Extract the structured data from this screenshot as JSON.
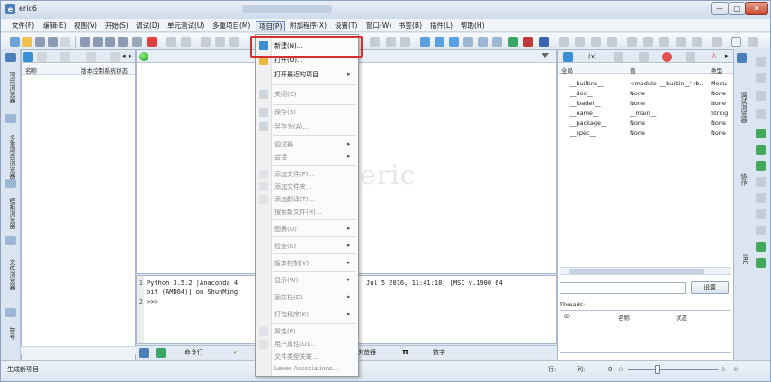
{
  "window": {
    "title": "eric6"
  },
  "menubar": [
    "文件(F)",
    "编辑(E)",
    "视图(V)",
    "开始(S)",
    "调试(D)",
    "单元测试(U)",
    "多重项目(M)",
    "项目(P)",
    "附加程序(X)",
    "设置(T)",
    "窗口(W)",
    "书签(B)",
    "插件(L)",
    "帮助(H)"
  ],
  "project_browser": {
    "columns": [
      "名称",
      "版本控制系统状态"
    ]
  },
  "left_tabs": [
    "项目浏览器",
    "多重项目浏览器",
    "模板浏览器",
    "文件浏览器",
    "符号"
  ],
  "editor": {
    "watermark": "eric"
  },
  "shell": {
    "lines": [
      "Python 3.5.2 |Anaconda 4",
      "bit (AMD64)] on ShunMing",
      ">>>"
    ],
    "line_tail": "Jul  5 2016, 11:41:18) [MSC v.1900 64",
    "line_numbers": [
      "1",
      "",
      "2"
    ]
  },
  "bottom_tabs": [
    "命令行",
    "浏览器",
    "π",
    "数字"
  ],
  "project_menu": {
    "items": [
      {
        "label": "新建(N)...",
        "disabled": false,
        "submenu": false
      },
      {
        "label": "打开(O)...",
        "disabled": false,
        "submenu": false
      },
      {
        "label": "打开最近的项目",
        "disabled": false,
        "submenu": true
      },
      {
        "label": "关闭(C)",
        "disabled": true,
        "submenu": false
      },
      {
        "label": "保存(S)",
        "disabled": true,
        "submenu": false
      },
      {
        "label": "另存为(A)...",
        "disabled": true,
        "submenu": false
      },
      {
        "label": "调试器",
        "disabled": true,
        "submenu": true
      },
      {
        "label": "会话",
        "disabled": true,
        "submenu": true
      },
      {
        "label": "添加文件(F)...",
        "disabled": true,
        "submenu": false
      },
      {
        "label": "添加文件夹...",
        "disabled": true,
        "submenu": false
      },
      {
        "label": "添加翻译(T)...",
        "disabled": true,
        "submenu": false
      },
      {
        "label": "搜索新文件(H)...",
        "disabled": true,
        "submenu": false
      },
      {
        "label": "图表(D)",
        "disabled": true,
        "submenu": true
      },
      {
        "label": "检查(K)",
        "disabled": true,
        "submenu": true
      },
      {
        "label": "版本控制(V)",
        "disabled": true,
        "submenu": true
      },
      {
        "label": "显示(W)",
        "disabled": true,
        "submenu": true
      },
      {
        "label": "源文档(D)",
        "disabled": true,
        "submenu": true
      },
      {
        "label": "打包程序(K)",
        "disabled": true,
        "submenu": true
      },
      {
        "label": "属性(P)...",
        "disabled": true,
        "submenu": false
      },
      {
        "label": "用户属性(U)...",
        "disabled": true,
        "submenu": false
      },
      {
        "label": "文件类型关联...",
        "disabled": true,
        "submenu": false
      },
      {
        "label": "Lexer Associations...",
        "disabled": true,
        "submenu": false
      }
    ]
  },
  "variables": {
    "columns": [
      "全局",
      "值",
      "类型"
    ],
    "rows": [
      {
        "name": "__builtins__",
        "value": "<module '__builtin__' (b...",
        "type": "Modu"
      },
      {
        "name": "__doc__",
        "value": "None",
        "type": "None"
      },
      {
        "name": "__loader__",
        "value": "None",
        "type": "None"
      },
      {
        "name": "__name__",
        "value": "__main__",
        "type": "String"
      },
      {
        "name": "__package__",
        "value": "None",
        "type": "None"
      },
      {
        "name": "__spec__",
        "value": "None",
        "type": "None"
      }
    ],
    "filter_button": "设置"
  },
  "threads": {
    "label": "Threads:",
    "columns": [
      "ID",
      "名称",
      "状态"
    ]
  },
  "right_tabs": [
    "调试浏览器",
    "协作",
    "IRC"
  ],
  "statusbar": {
    "message": "生成新项目",
    "line_label": "行:",
    "col_label": "列:",
    "zoom_value": "0"
  },
  "colors": {
    "highlight": "#d43030",
    "accent": "#4a7fb8"
  }
}
